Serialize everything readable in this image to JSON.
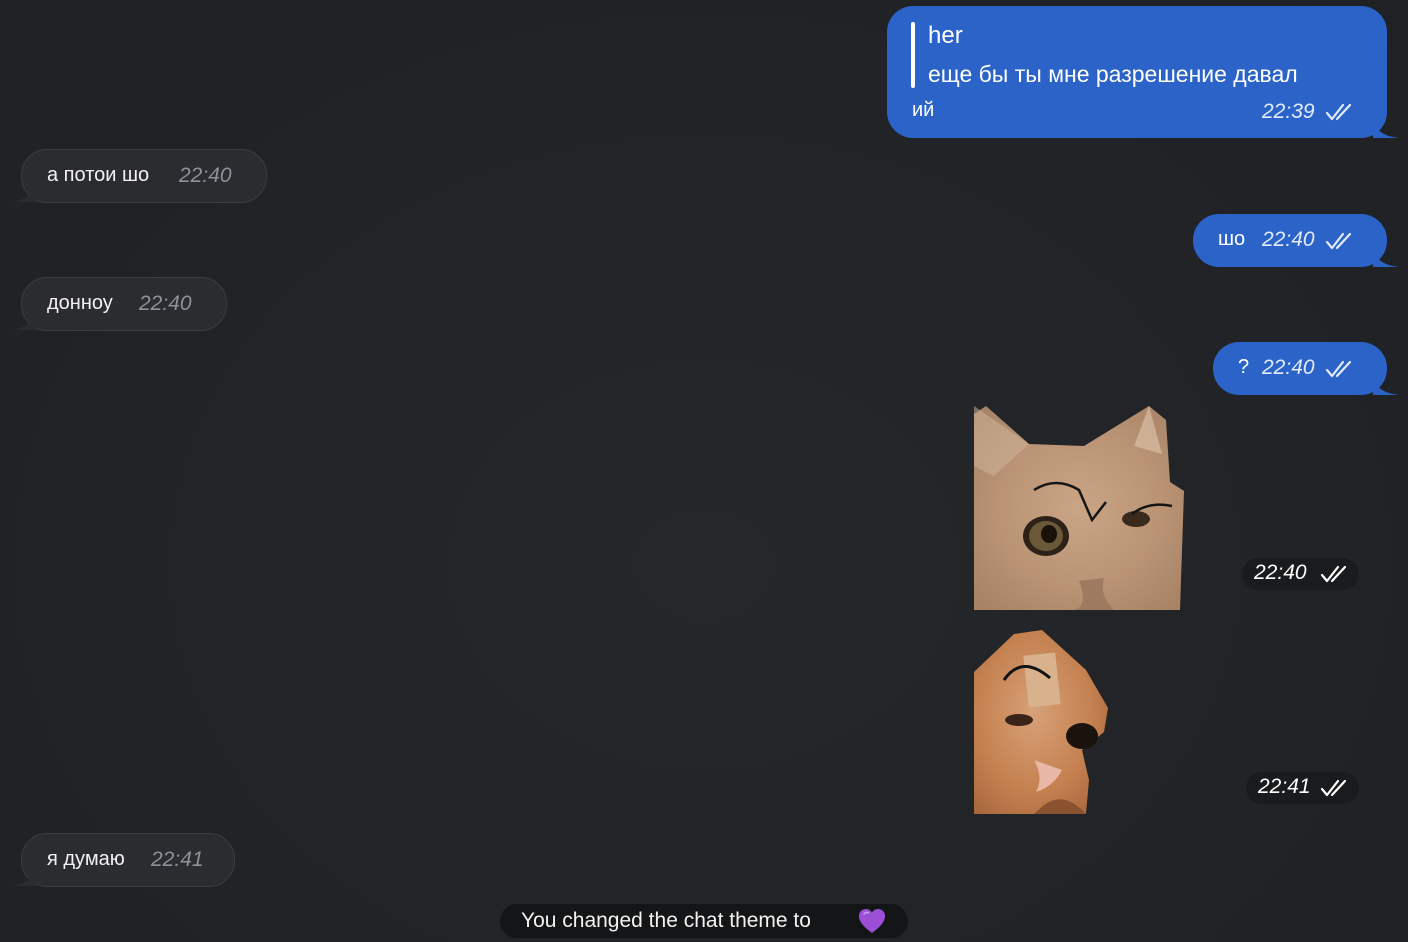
{
  "messages": {
    "m1": {
      "reply_author": "her",
      "reply_text": "еще бы ты мне разрешение давал",
      "text": "ий",
      "time": "22:39"
    },
    "m2": {
      "text": "а потои шо",
      "time": "22:40"
    },
    "m3": {
      "text": "шо",
      "time": "22:40"
    },
    "m4": {
      "text": "донноу",
      "time": "22:40"
    },
    "m5": {
      "text": "?",
      "time": "22:40"
    },
    "sticker1": {
      "time": "22:40",
      "subject": "cat with drawn eyebrows"
    },
    "sticker2": {
      "time": "22:41",
      "subject": "cat with drawn eyebrows"
    },
    "m6": {
      "text": "я думаю",
      "time": "22:41"
    }
  },
  "service_message": {
    "text": "You changed the chat theme to",
    "emoji": "💜"
  },
  "colors": {
    "background": "#222427",
    "outgoing_bubble": "#2b63c9",
    "incoming_bubble": "#2a2c2f"
  },
  "icons": {
    "read_status": "double-check-icon"
  }
}
